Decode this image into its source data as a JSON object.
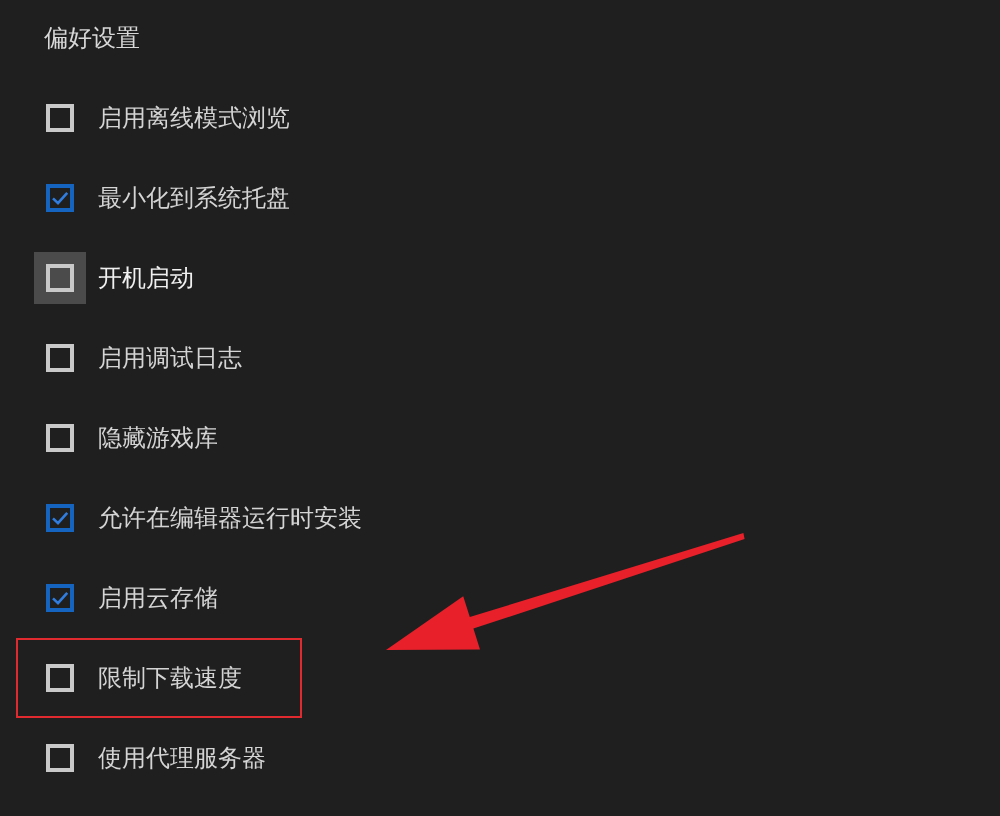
{
  "section_title": "偏好设置",
  "options": [
    {
      "label": "启用离线模式浏览",
      "checked": false,
      "hovered": false,
      "highlighted": false
    },
    {
      "label": "最小化到系统托盘",
      "checked": true,
      "hovered": false,
      "highlighted": false
    },
    {
      "label": "开机启动",
      "checked": false,
      "hovered": true,
      "highlighted": false
    },
    {
      "label": "启用调试日志",
      "checked": false,
      "hovered": false,
      "highlighted": false
    },
    {
      "label": "隐藏游戏库",
      "checked": false,
      "hovered": false,
      "highlighted": false
    },
    {
      "label": "允许在编辑器运行时安装",
      "checked": true,
      "hovered": false,
      "highlighted": false
    },
    {
      "label": "启用云存储",
      "checked": true,
      "hovered": false,
      "highlighted": false
    },
    {
      "label": "限制下载速度",
      "checked": false,
      "hovered": false,
      "highlighted": true
    },
    {
      "label": "使用代理服务器",
      "checked": false,
      "hovered": false,
      "highlighted": false
    }
  ]
}
